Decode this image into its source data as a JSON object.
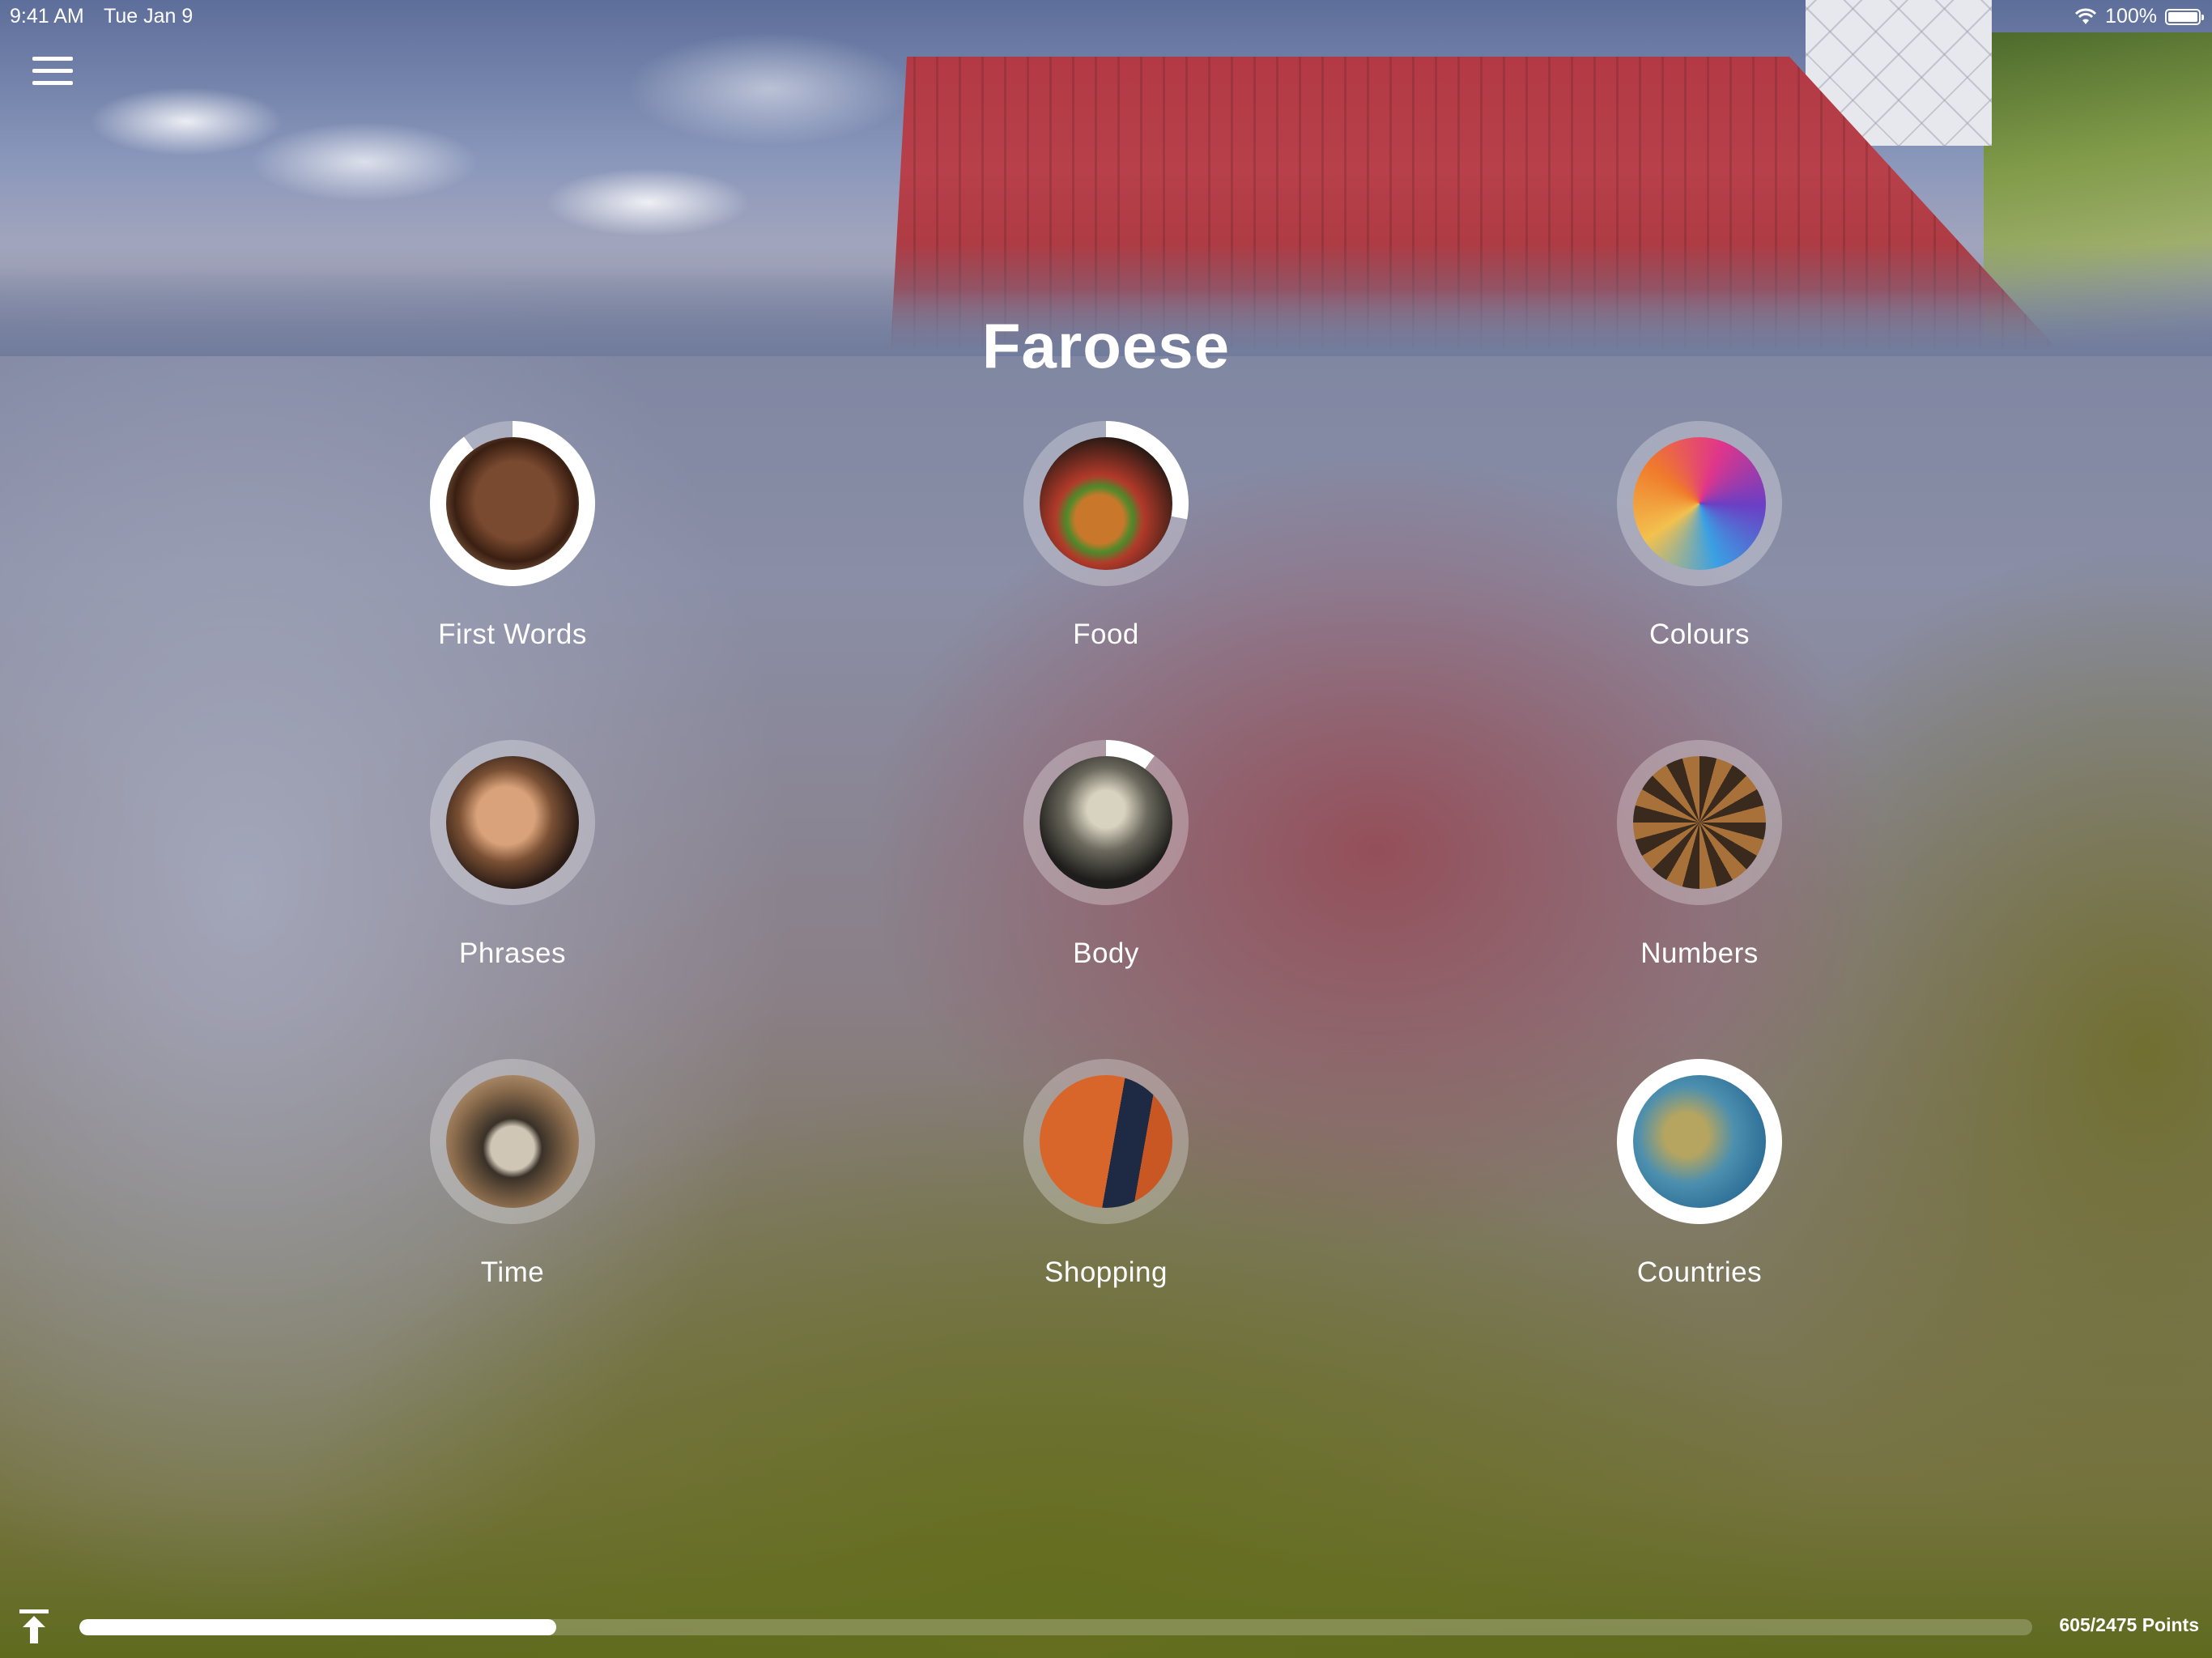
{
  "status_bar": {
    "time": "9:41 AM",
    "date": "Tue Jan 9",
    "battery": "100%",
    "wifi_icon": "wifi-icon",
    "battery_icon": "battery-icon"
  },
  "header": {
    "menu_icon": "hamburger-menu-icon",
    "title": "Faroese"
  },
  "categories": [
    {
      "label": "First Words",
      "progress": 0.9,
      "thumb": "child-photo"
    },
    {
      "label": "Food",
      "progress": 0.28,
      "thumb": "burger-photo"
    },
    {
      "label": "Colours",
      "progress": 0.0,
      "thumb": "colour-powder-photo"
    },
    {
      "label": "Phrases",
      "progress": 0.0,
      "thumb": "woman-photo"
    },
    {
      "label": "Body",
      "progress": 0.1,
      "thumb": "skeleton-photo"
    },
    {
      "label": "Numbers",
      "progress": 0.0,
      "thumb": "letterpress-numbers-photo"
    },
    {
      "label": "Time",
      "progress": 0.0,
      "thumb": "alarm-clock-photo"
    },
    {
      "label": "Shopping",
      "progress": 0.0,
      "thumb": "shopping-cart-photo"
    },
    {
      "label": "Countries",
      "progress": 1.0,
      "thumb": "map-photo"
    }
  ],
  "footer": {
    "upload_icon": "upload-arrow-icon",
    "points_text": "605/2475 Points",
    "points_fraction": 0.244
  },
  "colors": {
    "ring_track": "rgba(255,255,255,0.28)",
    "ring_progress": "#ffffff",
    "progress_fill": "#ffffff"
  }
}
